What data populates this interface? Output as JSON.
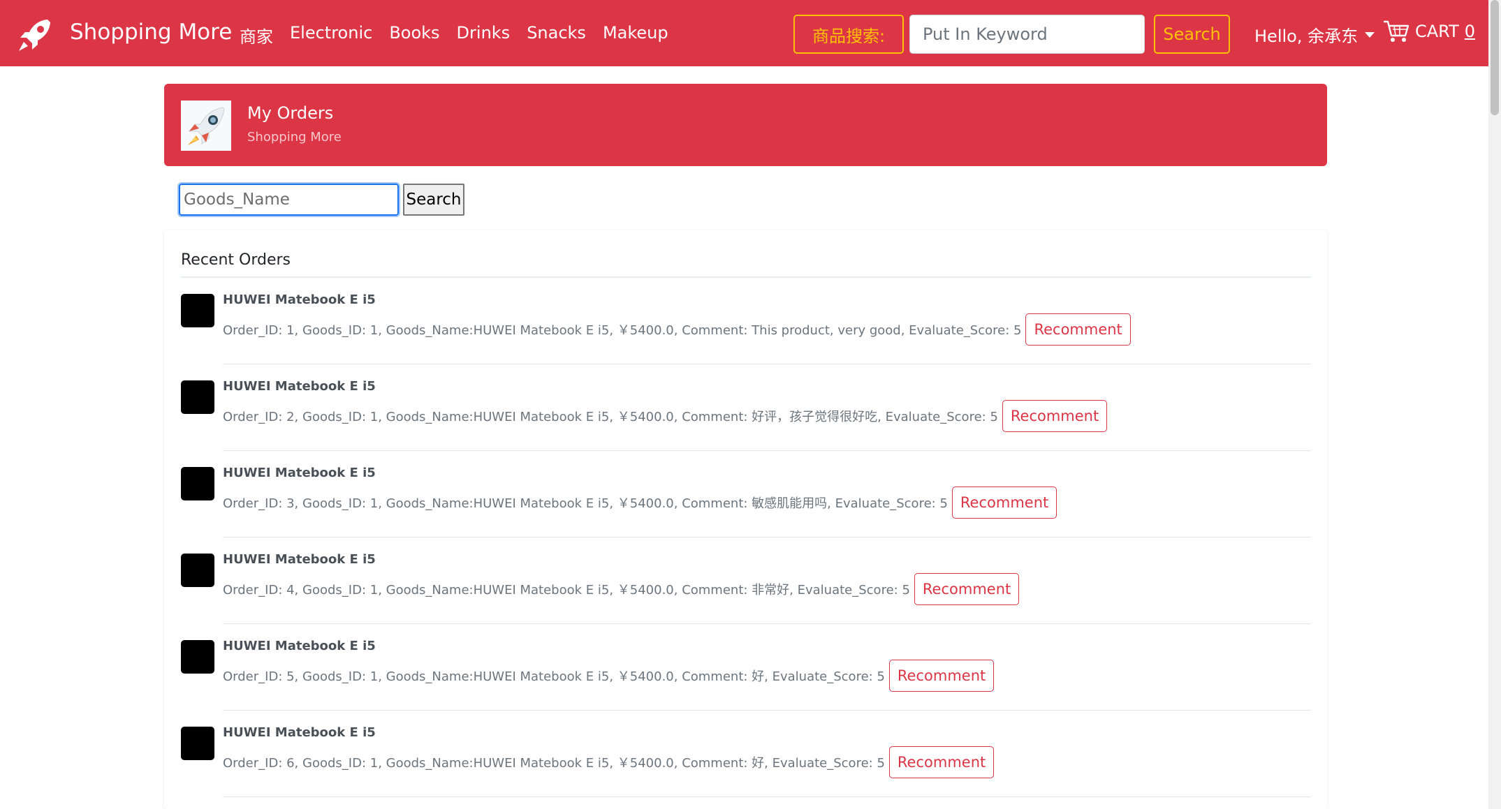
{
  "navbar": {
    "brand": "Shopping More",
    "links": [
      "商家",
      "Electronic",
      "Books",
      "Drinks",
      "Snacks",
      "Makeup"
    ],
    "search_label": "商品搜索:",
    "search_placeholder": "Put In Keyword",
    "search_button": "Search",
    "user_greeting": "Hello, 余承东",
    "cart_label": "CART",
    "cart_count": "0",
    "colors": {
      "primary": "#dc3545",
      "accent": "#ffc107"
    }
  },
  "header": {
    "title": "My Orders",
    "subtitle": "Shopping More"
  },
  "goods_search": {
    "placeholder": "Goods_Name",
    "button": "Search"
  },
  "orders": {
    "title": "Recent Orders",
    "button_label": "Recomment",
    "items": [
      {
        "name": "HUWEI Matebook E i5",
        "details": "Order_ID: 1, Goods_ID: 1, Goods_Name:HUWEI Matebook E i5, ￥5400.0, Comment: This product, very good, Evaluate_Score: 5"
      },
      {
        "name": "HUWEI Matebook E i5",
        "details": "Order_ID: 2, Goods_ID: 1, Goods_Name:HUWEI Matebook E i5, ￥5400.0, Comment: 好评，孩子觉得很好吃, Evaluate_Score: 5"
      },
      {
        "name": "HUWEI Matebook E i5",
        "details": "Order_ID: 3, Goods_ID: 1, Goods_Name:HUWEI Matebook E i5, ￥5400.0, Comment: 敏感肌能用吗, Evaluate_Score: 5"
      },
      {
        "name": "HUWEI Matebook E i5",
        "details": "Order_ID: 4, Goods_ID: 1, Goods_Name:HUWEI Matebook E i5, ￥5400.0, Comment: 非常好, Evaluate_Score: 5"
      },
      {
        "name": "HUWEI Matebook E i5",
        "details": "Order_ID: 5, Goods_ID: 1, Goods_Name:HUWEI Matebook E i5, ￥5400.0, Comment: 好, Evaluate_Score: 5"
      },
      {
        "name": "HUWEI Matebook E i5",
        "details": "Order_ID: 6, Goods_ID: 1, Goods_Name:HUWEI Matebook E i5, ￥5400.0, Comment: 好, Evaluate_Score: 5"
      }
    ]
  }
}
